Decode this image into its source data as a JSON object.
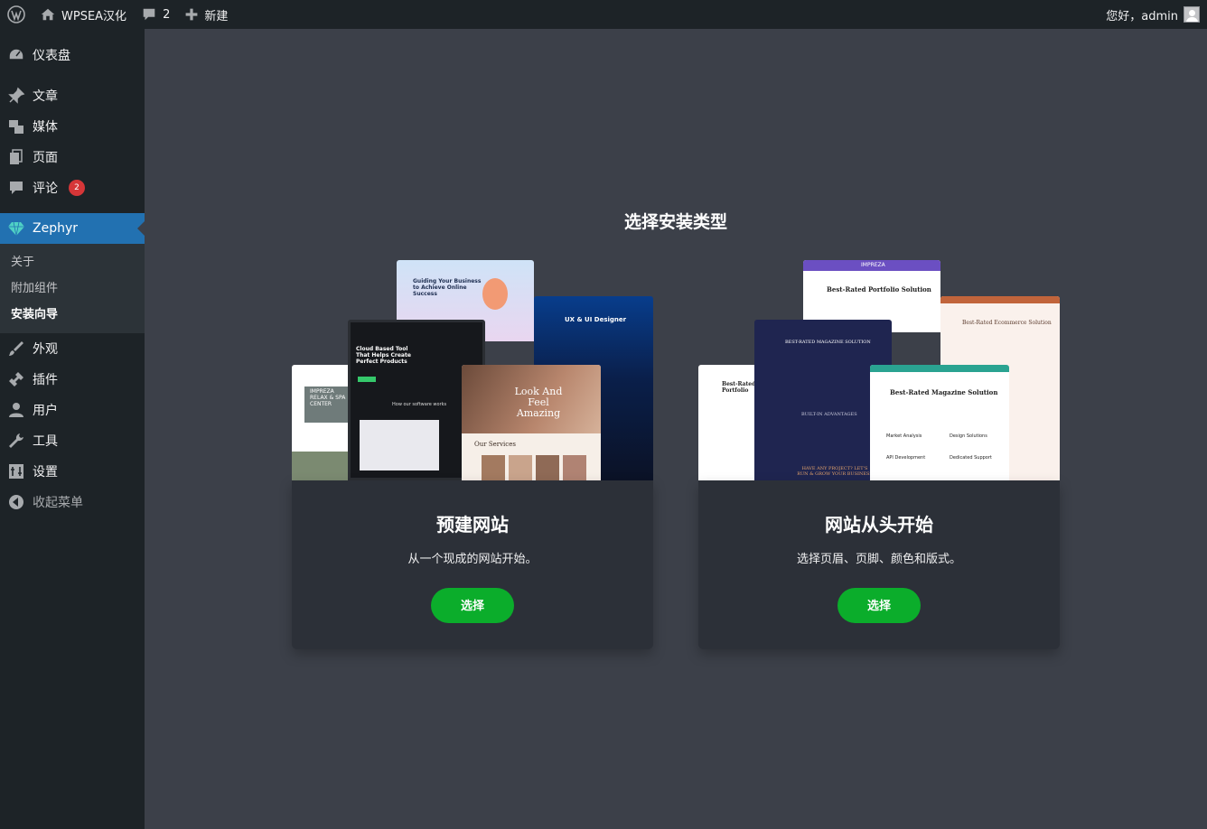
{
  "adminbar": {
    "site_name": "WPSEA汉化",
    "comments_count": "2",
    "new_label": "新建",
    "greeting": "您好，admin"
  },
  "sidebar": {
    "items": [
      {
        "label": "仪表盘",
        "icon": "dashboard-icon"
      },
      {
        "label": "文章",
        "icon": "pin-icon"
      },
      {
        "label": "媒体",
        "icon": "media-icon"
      },
      {
        "label": "页面",
        "icon": "page-icon"
      },
      {
        "label": "评论",
        "icon": "comment-icon",
        "badge": "2"
      },
      {
        "label": "Zephyr",
        "icon": "diamond-icon"
      },
      {
        "label": "外观",
        "icon": "brush-icon"
      },
      {
        "label": "插件",
        "icon": "plugin-icon"
      },
      {
        "label": "用户",
        "icon": "user-icon"
      },
      {
        "label": "工具",
        "icon": "wrench-icon"
      },
      {
        "label": "设置",
        "icon": "settings-icon"
      },
      {
        "label": "收起菜单",
        "icon": "collapse-icon"
      }
    ],
    "submenu": [
      "关于",
      "附加组件",
      "安装向导"
    ]
  },
  "main": {
    "title": "选择安装类型",
    "cards": [
      {
        "title": "预建网站",
        "desc": "从一个现成的网站开始。",
        "button": "选择",
        "preview_texts": [
          "Guiding Your Business to Achieve Online Success",
          "Cloud Based Tool That Helps Create Perfect Products",
          "UX & UI Designer",
          "IMPREZA RELAX & SPA CENTER",
          "Look And Feel Amazing",
          "Our Services",
          "How our software works"
        ]
      },
      {
        "title": "网站从头开始",
        "desc": "选择页眉、页脚、颜色和版式。",
        "button": "选择",
        "preview_texts": [
          "IMPREZA",
          "Best-Rated Portfolio Solution",
          "Best-Rated Magazine Solution",
          "Best-Rated Ecommerce Solution",
          "BEST-RATED MAGAZINE SOLUTION",
          "Best-Rated Portfolio",
          "Market Analysis",
          "Design Solutions",
          "API Development",
          "Dedicated Support",
          "BUILT-IN ADVANTAGES",
          "HAVE ANY PROJECT? LET'S RUN & GROW YOUR BUSINESS"
        ]
      }
    ]
  },
  "colors": {
    "adminbar_bg": "#1d2327",
    "sidebar_bg": "#1d2327",
    "active_menu": "#2271b1",
    "main_bg": "#3c4049",
    "card_bg": "#2c3038",
    "button_green": "#0bad2b",
    "badge_red": "#d63638"
  }
}
